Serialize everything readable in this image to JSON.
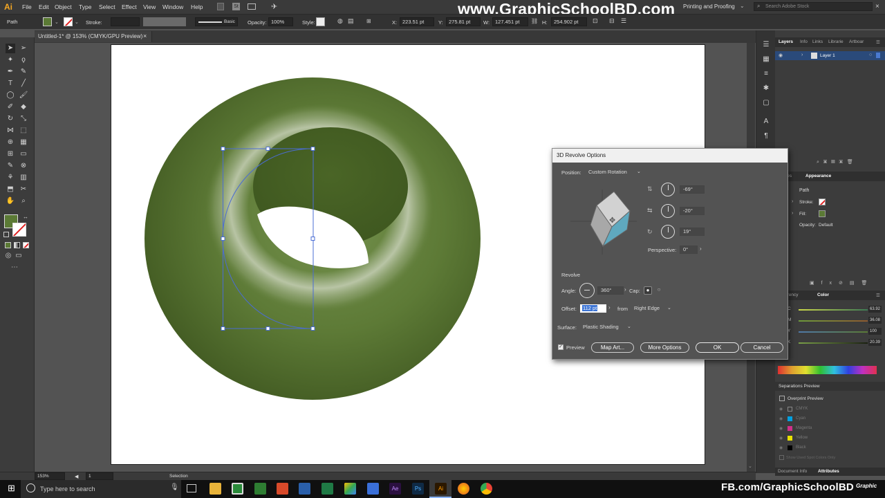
{
  "app": {
    "logo": "Ai",
    "watermark": "www.GraphicSchoolBD.com",
    "watermark_bottom": "FB.com/GraphicSchoolBD",
    "corner_logo": "Graphic"
  },
  "menu": [
    "File",
    "Edit",
    "Object",
    "Type",
    "Select",
    "Effect",
    "View",
    "Window",
    "Help"
  ],
  "workspace": {
    "label": "Printing and Proofing",
    "search_placeholder": "Search Adobe Stock"
  },
  "control_bar": {
    "selection": "Path",
    "stroke_label": "Stroke:",
    "brush_value": "Basic",
    "opacity_label": "Opacity:",
    "opacity_value": "100%",
    "style_label": "Style:",
    "x_label": "X:",
    "x_value": "223.51 pt",
    "y_label": "Y:",
    "y_value": "275.81 pt",
    "w_label": "W:",
    "w_value": "127.451 pt",
    "h_label": "H:",
    "h_value": "254.902 pt"
  },
  "document_tab": {
    "title": "Untitled-1* @ 153% (CMYK/GPU Preview)",
    "close": "×"
  },
  "status_bar": {
    "zoom": "153%",
    "artboard_num": "1",
    "tool": "Selection"
  },
  "layers_panel": {
    "tabs": [
      "Layers",
      "Info",
      "Links",
      "Librarie",
      "Artboar"
    ],
    "layer_name": "Layer 1"
  },
  "appearance_panel": {
    "tabs": [
      "...ches",
      "Appearance"
    ],
    "object": "Path",
    "stroke_label": "Stroke:",
    "fill_label": "Fill:",
    "opacity_label": "Opacity:",
    "opacity_value": "Default"
  },
  "color_panel": {
    "tabs": [
      "...parency",
      "Color"
    ],
    "channels": [
      {
        "name": "C",
        "value": "63.92",
        "color": "#00a0e0"
      },
      {
        "name": "M",
        "value": "36.08",
        "color": "#d0308a"
      },
      {
        "name": "Y",
        "value": "100",
        "color": "#e8e000"
      },
      {
        "name": "K",
        "value": "20.39",
        "color": "#888888"
      }
    ]
  },
  "separations_panel": {
    "title": "Separations Preview",
    "overprint": "Overprint Preview",
    "inks": [
      "CMYK",
      "Cyan",
      "Magenta",
      "Yellow",
      "Black"
    ],
    "spot_label": "Show Used Spot Colors Only"
  },
  "bottom_tabs": [
    "Document Info",
    "Attributes"
  ],
  "dialog": {
    "title": "3D Revolve Options",
    "position_label": "Position:",
    "position_value": "Custom Rotation",
    "rot_x": "-69°",
    "rot_y": "-20°",
    "rot_z": "19°",
    "perspective_label": "Perspective:",
    "perspective_value": "0°",
    "revolve_header": "Revolve",
    "angle_label": "Angle:",
    "angle_value": "360°",
    "cap_label": "Cap:",
    "offset_label": "Offset:",
    "offset_value": "112 pt",
    "from_label": "from",
    "from_value": "Right Edge",
    "surface_label": "Surface:",
    "surface_value": "Plastic Shading",
    "preview_label": "Preview",
    "map_art": "Map Art...",
    "more_options": "More Options",
    "ok": "OK",
    "cancel": "Cancel"
  },
  "taskbar": {
    "search_placeholder": "Type here to search"
  },
  "colors": {
    "fill": "#5b7a35",
    "accent_blue": "#4a6cd4"
  }
}
